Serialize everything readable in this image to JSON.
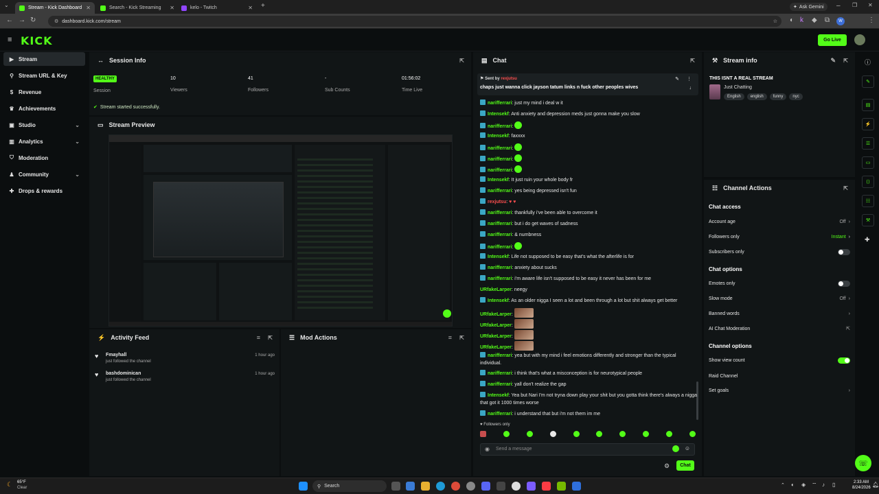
{
  "browser": {
    "tabs": [
      {
        "label": "Stream - Kick Dashboard",
        "color": "#53fc18",
        "active": true
      },
      {
        "label": "Search - Kick Streaming",
        "color": "#53fc18",
        "active": false
      },
      {
        "label": "kelo - Twitch",
        "color": "#9146ff",
        "active": false
      }
    ],
    "ask_gemini": "Ask Gemini",
    "url": "dashboard.kick.com/stream"
  },
  "header": {
    "logo": "KICK",
    "go_live": "Go Live"
  },
  "sidebar": {
    "items": [
      {
        "label": "Stream",
        "icon": "play-icon",
        "active": true,
        "expandable": false
      },
      {
        "label": "Stream URL & Key",
        "icon": "link-icon",
        "active": false,
        "expandable": false
      },
      {
        "label": "Revenue",
        "icon": "dollar-icon",
        "active": false,
        "expandable": false
      },
      {
        "label": "Achievements",
        "icon": "trophy-icon",
        "active": false,
        "expandable": false
      },
      {
        "label": "Studio",
        "icon": "studio-icon",
        "active": false,
        "expandable": true
      },
      {
        "label": "Analytics",
        "icon": "chart-icon",
        "active": false,
        "expandable": true
      },
      {
        "label": "Moderation",
        "icon": "shield-icon",
        "active": false,
        "expandable": false
      },
      {
        "label": "Community",
        "icon": "users-icon",
        "active": false,
        "expandable": true
      },
      {
        "label": "Drops & rewards",
        "icon": "gift-icon",
        "active": false,
        "expandable": false
      }
    ]
  },
  "session": {
    "title": "Session Info",
    "health": "HEALTHY",
    "stats": [
      {
        "value": "",
        "label": "Session"
      },
      {
        "value": "10",
        "label": "Viewers"
      },
      {
        "value": "41",
        "label": "Followers"
      },
      {
        "value": "-",
        "label": "Sub Counts"
      },
      {
        "value": "01:56:02",
        "label": "Time Live"
      }
    ],
    "status": "Stream started successfully."
  },
  "preview": {
    "title": "Stream Preview"
  },
  "activity": {
    "title": "Activity Feed",
    "items": [
      {
        "user": "Fmayhall",
        "action": "just followed the channel",
        "time": "1 hour ago"
      },
      {
        "user": "bashdominican",
        "action": "just followed the channel",
        "time": "1 hour ago"
      }
    ]
  },
  "mod_actions": {
    "title": "Mod Actions"
  },
  "chat": {
    "title": "Chat",
    "pinned": {
      "sent_by_label": "Sent by",
      "sent_by": "rexjutsu",
      "text": "chaps just wanna click jayson tatum links n fuck other peoples wives"
    },
    "messages": [
      {
        "user": "narifferrari",
        "text": "just my mind i deal w it",
        "type": "text"
      },
      {
        "user": "Intensekf",
        "text": "Anti anxiety and depression meds just gonna make you slow",
        "type": "text"
      },
      {
        "user": "narifferrari",
        "text": "",
        "type": "emote"
      },
      {
        "user": "Intensekf",
        "text": "faxxxx",
        "type": "text"
      },
      {
        "user": "narifferrari",
        "text": "",
        "type": "emote"
      },
      {
        "user": "narifferrari",
        "text": "",
        "type": "emote"
      },
      {
        "user": "narifferrari",
        "text": "",
        "type": "emote"
      },
      {
        "user": "Intensekf",
        "text": "It just ruin your whole body fr",
        "type": "text"
      },
      {
        "user": "narifferrari",
        "text": "yes being depressed isn't fun",
        "type": "text"
      },
      {
        "user": "rexjutsu",
        "text": "",
        "type": "emote-red"
      },
      {
        "user": "narifferrari",
        "text": "thankfully i've been able to overcome it",
        "type": "text"
      },
      {
        "user": "narifferrari",
        "text": "but i do get waves of sadness",
        "type": "text"
      },
      {
        "user": "narifferrari",
        "text": "& numbness",
        "type": "text"
      },
      {
        "user": "narifferrari",
        "text": "",
        "type": "emote"
      },
      {
        "user": "Intensekf",
        "text": "Life not supposed to be easy that's what the afterlife is for",
        "type": "text"
      },
      {
        "user": "narifferrari",
        "text": "anxiety about sucks",
        "type": "text"
      },
      {
        "user": "narifferrari",
        "text": "i'm aware life isn't supposed to be easy it never has been for me",
        "type": "text"
      },
      {
        "user": "URfakeLarper",
        "text": "neegy",
        "type": "text-nobadge"
      },
      {
        "user": "Intensekf",
        "text": "As an older nigga I seen a lot and been through a lot but shit always get better",
        "type": "text"
      },
      {
        "user": "URfakeLarper",
        "text": "",
        "type": "img"
      },
      {
        "user": "URfakeLarper",
        "text": "",
        "type": "img"
      },
      {
        "user": "URfakeLarper",
        "text": "",
        "type": "img"
      },
      {
        "user": "URfakeLarper",
        "text": "",
        "type": "img"
      },
      {
        "user": "narifferrari",
        "text": "yea but with my mind i feel emotions differently and stronger than the typical individual.",
        "type": "text"
      },
      {
        "user": "narifferrari",
        "text": "i think that's what a misconception is for neurotypical people",
        "type": "text"
      },
      {
        "user": "narifferrari",
        "text": "yall don't realize the gap",
        "type": "text"
      },
      {
        "user": "Intensekf",
        "text": "Yea but Nari I'm not tryna down play your shit but you gotta think there's always a nigga that got it 1000 times worse",
        "type": "text"
      },
      {
        "user": "narifferrari",
        "text": "i understand that but i'm not them im me",
        "type": "text"
      }
    ],
    "followers_only": "Followers only",
    "input_placeholder": "Send a message",
    "send_label": "Chat"
  },
  "stream_info": {
    "title": "Stream info",
    "stream_title": "THIS ISNT A REAL STREAM",
    "category": "Just Chatting",
    "tags": [
      "English",
      "english",
      "funny",
      "nyc"
    ]
  },
  "channel_actions": {
    "title": "Channel Actions",
    "chat_access": "Chat access",
    "account_age": {
      "label": "Account age",
      "value": "Off"
    },
    "followers_only": {
      "label": "Followers only",
      "value": "Instant"
    },
    "subscribers_only": {
      "label": "Subscribers only",
      "on": false
    },
    "chat_options": "Chat options",
    "emotes_only": {
      "label": "Emotes only",
      "on": false
    },
    "slow_mode": {
      "label": "Slow mode",
      "value": "Off"
    },
    "banned_words": "Banned words",
    "ai_moderation": "AI Chat Moderation",
    "channel_options": "Channel options",
    "show_view_count": {
      "label": "Show view count",
      "on": true
    },
    "raid_channel": "Raid Channel",
    "set_goals": "Set goals"
  },
  "taskbar": {
    "weather_temp": "65°F",
    "weather_cond": "Clear",
    "search": "Search",
    "time": "2:33 AM",
    "date": "8/24/2026"
  }
}
